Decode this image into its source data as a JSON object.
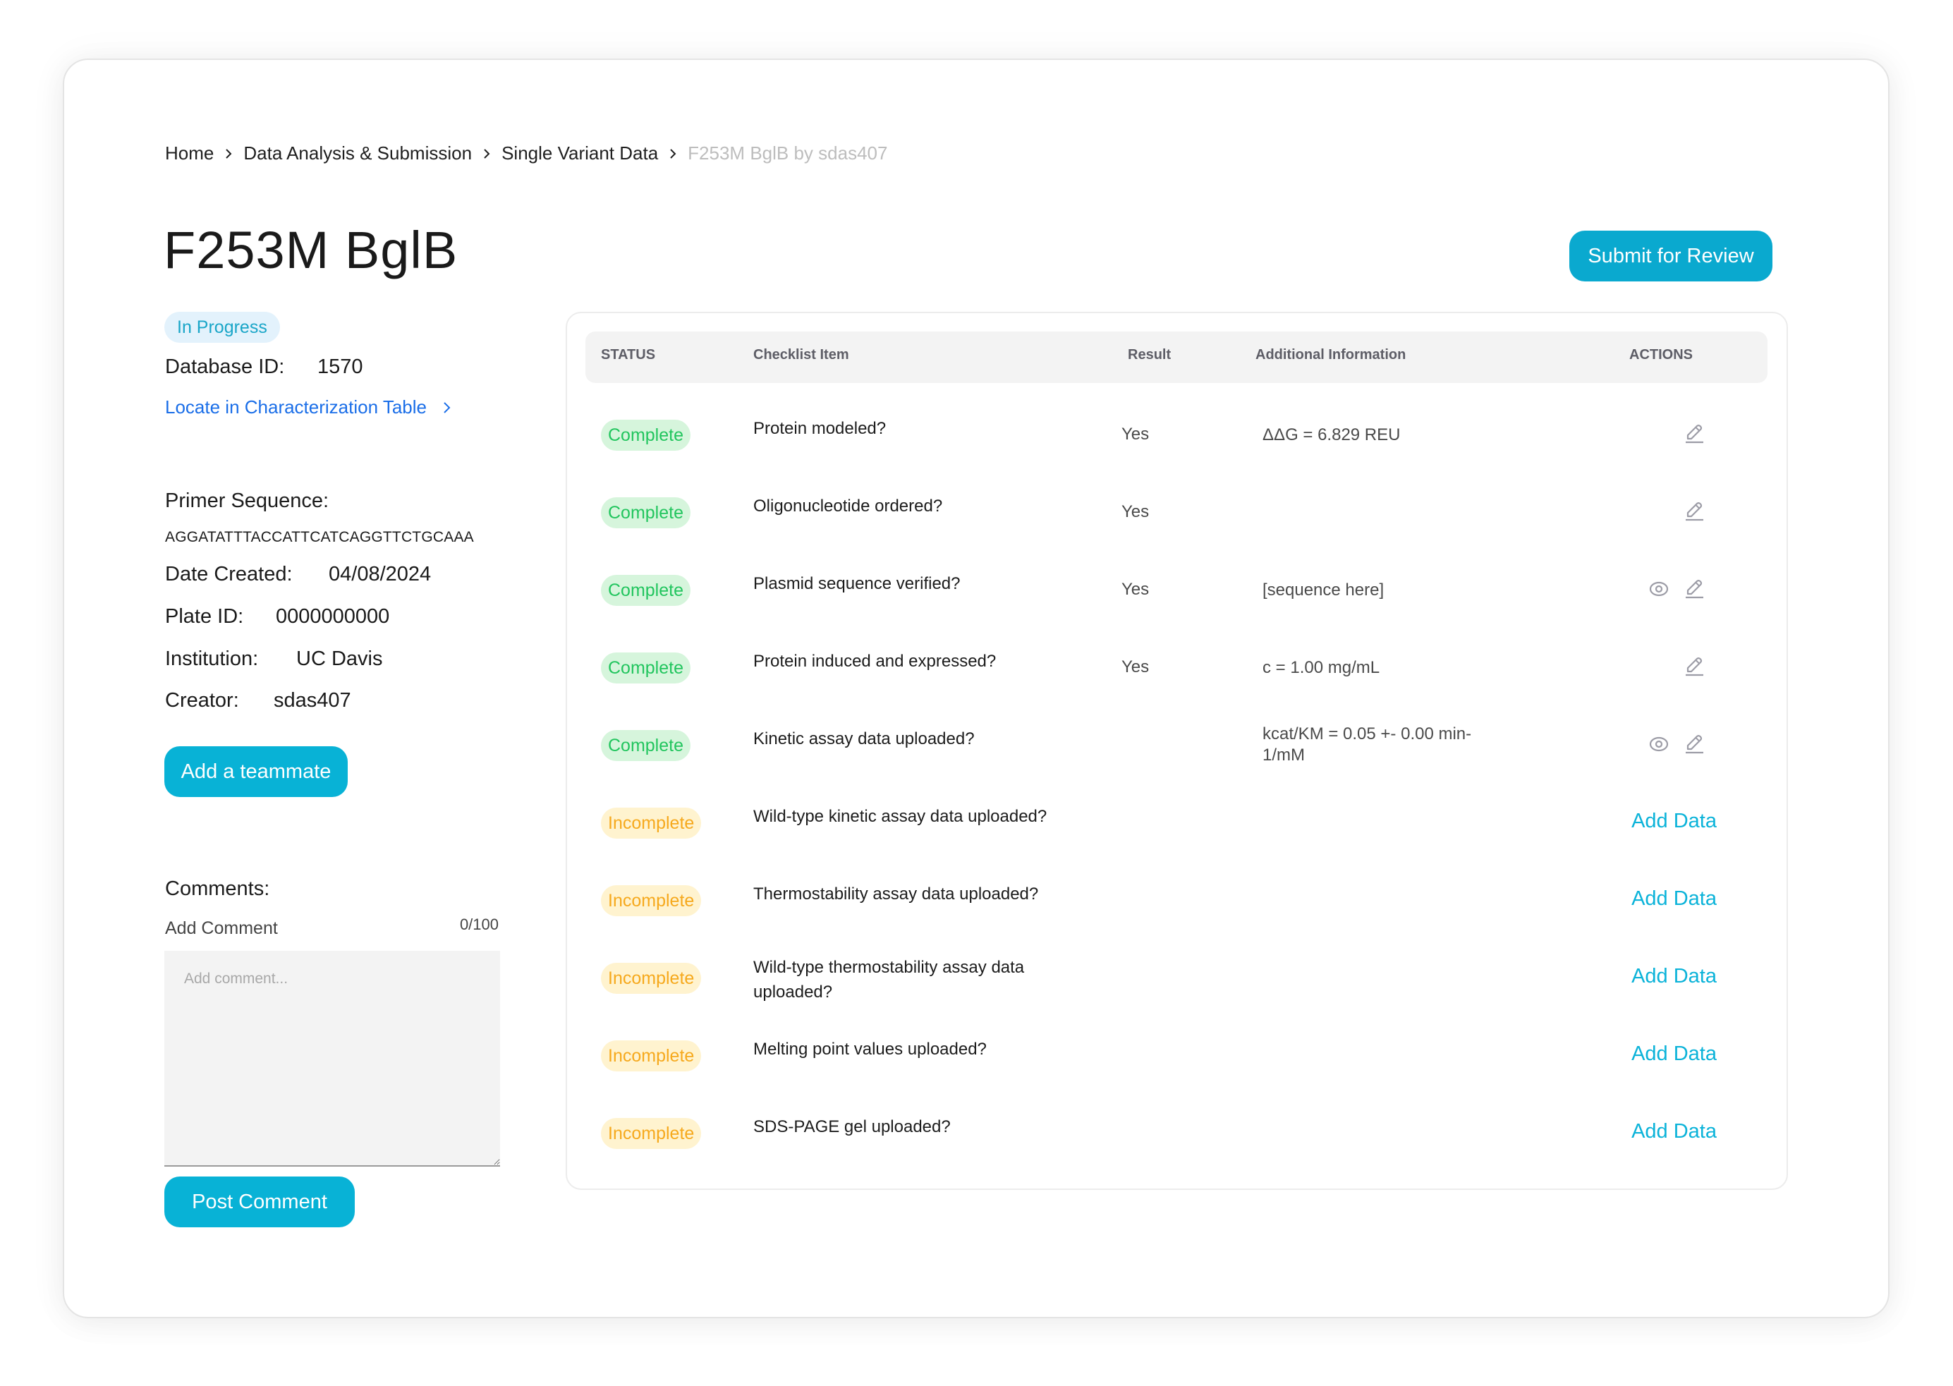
{
  "breadcrumb": [
    {
      "label": "Home",
      "current": false
    },
    {
      "label": "Data Analysis & Submission",
      "current": false
    },
    {
      "label": "Single Variant Data",
      "current": false
    },
    {
      "label": "F253M BglB by sdas407",
      "current": true
    }
  ],
  "page": {
    "title": "F253M BglB",
    "status": "In Progress",
    "submit_label": "Submit for Review"
  },
  "details": {
    "database_id_label": "Database ID:",
    "database_id": "1570",
    "locate_link": "Locate in Characterization Table",
    "primer_label": "Primer Sequence:",
    "primer_sequence": "AGGATATTTACCATTCATCAGGTTCTGCAAA",
    "date_label": "Date Created:",
    "date": "04/08/2024",
    "plate_label": "Plate ID:",
    "plate_id": "0000000000",
    "institution_label": "Institution:",
    "institution": "UC Davis",
    "creator_label": "Creator:",
    "creator": "sdas407",
    "add_teammate_label": "Add a teammate"
  },
  "comments": {
    "heading": "Comments:",
    "add_label": "Add Comment",
    "char_count": "0/100",
    "placeholder": "Add comment...",
    "post_label": "Post Comment"
  },
  "table": {
    "headers": {
      "status": "STATUS",
      "item": "Checklist Item",
      "result": "Result",
      "info": "Additional Information",
      "actions": "ACTIONS"
    },
    "add_data_label": "Add Data",
    "rows": [
      {
        "status": "Complete",
        "item": "Protein modeled?",
        "result": "Yes",
        "info": "ΔΔG = 6.829 REU",
        "view": false,
        "edit": true
      },
      {
        "status": "Complete",
        "item": "Oligonucleotide ordered?",
        "result": "Yes",
        "info": "",
        "view": false,
        "edit": true
      },
      {
        "status": "Complete",
        "item": "Plasmid sequence verified?",
        "result": "Yes",
        "info": "[sequence here]",
        "view": true,
        "edit": true
      },
      {
        "status": "Complete",
        "item": "Protein induced and expressed?",
        "result": "Yes",
        "info": "c = 1.00 mg/mL",
        "view": false,
        "edit": true
      },
      {
        "status": "Complete",
        "item": "Kinetic assay data uploaded?",
        "result": "",
        "info": "kcat/KM = 0.05 +- 0.00 min-1/mM",
        "view": true,
        "edit": true
      },
      {
        "status": "Incomplete",
        "item": "Wild-type kinetic assay data uploaded?",
        "result": "",
        "info": "",
        "view": false,
        "edit": false
      },
      {
        "status": "Incomplete",
        "item": "Thermostability assay data uploaded?",
        "result": "",
        "info": "",
        "view": false,
        "edit": false
      },
      {
        "status": "Incomplete",
        "item": "Wild-type thermostability assay data uploaded?",
        "result": "",
        "info": "",
        "view": false,
        "edit": false
      },
      {
        "status": "Incomplete",
        "item": "Melting point values uploaded?",
        "result": "",
        "info": "",
        "view": false,
        "edit": false
      },
      {
        "status": "Incomplete",
        "item": "SDS-PAGE gel uploaded?",
        "result": "",
        "info": "",
        "view": false,
        "edit": false
      }
    ]
  },
  "colors": {
    "accent": "#0aa9cf",
    "link": "#1a6ee8",
    "complete_bg": "#d6f5dc",
    "complete_text": "#22c55e",
    "incomplete_bg": "#fff3cf",
    "incomplete_text": "#f6a91d",
    "status_pill_bg": "#e3f2fc",
    "status_pill_text": "#1aa6c8"
  }
}
